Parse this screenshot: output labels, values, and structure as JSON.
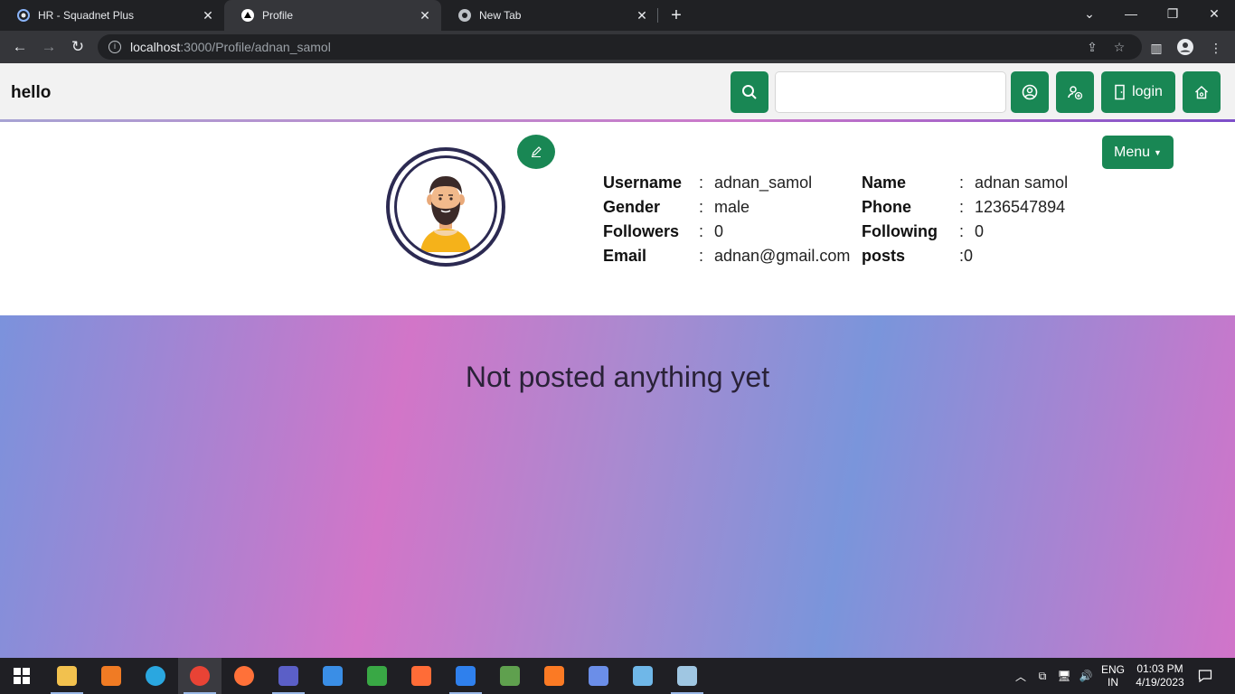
{
  "browser": {
    "tabs": [
      {
        "title": "HR - Squadnet Plus",
        "active": false
      },
      {
        "title": "Profile",
        "active": true
      },
      {
        "title": "New Tab",
        "active": false
      }
    ],
    "url_host": "localhost",
    "url_path": ":3000/Profile/adnan_samol"
  },
  "navbar": {
    "brand": "hello",
    "login_label": "login",
    "search_placeholder": ""
  },
  "profile": {
    "menu_label": "Menu",
    "left_fields": [
      {
        "label": "Username",
        "sep": ":",
        "value": "adnan_samol"
      },
      {
        "label": "Gender",
        "sep": ":",
        "value": "male"
      },
      {
        "label": "Followers",
        "sep": ":",
        "value": "0"
      },
      {
        "label": "Email",
        "sep": ":",
        "value": "adnan@gmail.com"
      }
    ],
    "right_fields": [
      {
        "label": "Name",
        "sep": ":",
        "value": "adnan samol"
      },
      {
        "label": "Phone",
        "sep": ":",
        "value": "1236547894"
      },
      {
        "label": "Following",
        "sep": ":",
        "value": "0"
      },
      {
        "label": "posts",
        "sep": ":",
        "value": "0"
      }
    ]
  },
  "posts": {
    "empty_message": "Not posted anything yet"
  },
  "taskbar": {
    "lang_top": "ENG",
    "lang_bottom": "IN",
    "time": "01:03 PM",
    "date": "4/19/2023",
    "apps": [
      {
        "name": "file-explorer-icon",
        "color": "#f2c14e"
      },
      {
        "name": "app-n-icon",
        "color": "#f07b24"
      },
      {
        "name": "edge-icon",
        "color": "#2aa7e0"
      },
      {
        "name": "chrome-icon",
        "color": "#e84335"
      },
      {
        "name": "firefox-icon",
        "color": "#ff7139"
      },
      {
        "name": "teams-icon",
        "color": "#5b5fc7"
      },
      {
        "name": "mail-icon",
        "color": "#3a8ee6"
      },
      {
        "name": "sheet-icon",
        "color": "#39a845"
      },
      {
        "name": "postman-icon",
        "color": "#ff6c37"
      },
      {
        "name": "vscode-icon",
        "color": "#2f80ed"
      },
      {
        "name": "node-icon",
        "color": "#5fa04e"
      },
      {
        "name": "xampp-icon",
        "color": "#fb7a24"
      },
      {
        "name": "network-tool-icon",
        "color": "#6b8ee8"
      },
      {
        "name": "bolt-app-icon",
        "color": "#6fb7e8"
      },
      {
        "name": "notes-app-icon",
        "color": "#9fc6e2"
      }
    ]
  }
}
